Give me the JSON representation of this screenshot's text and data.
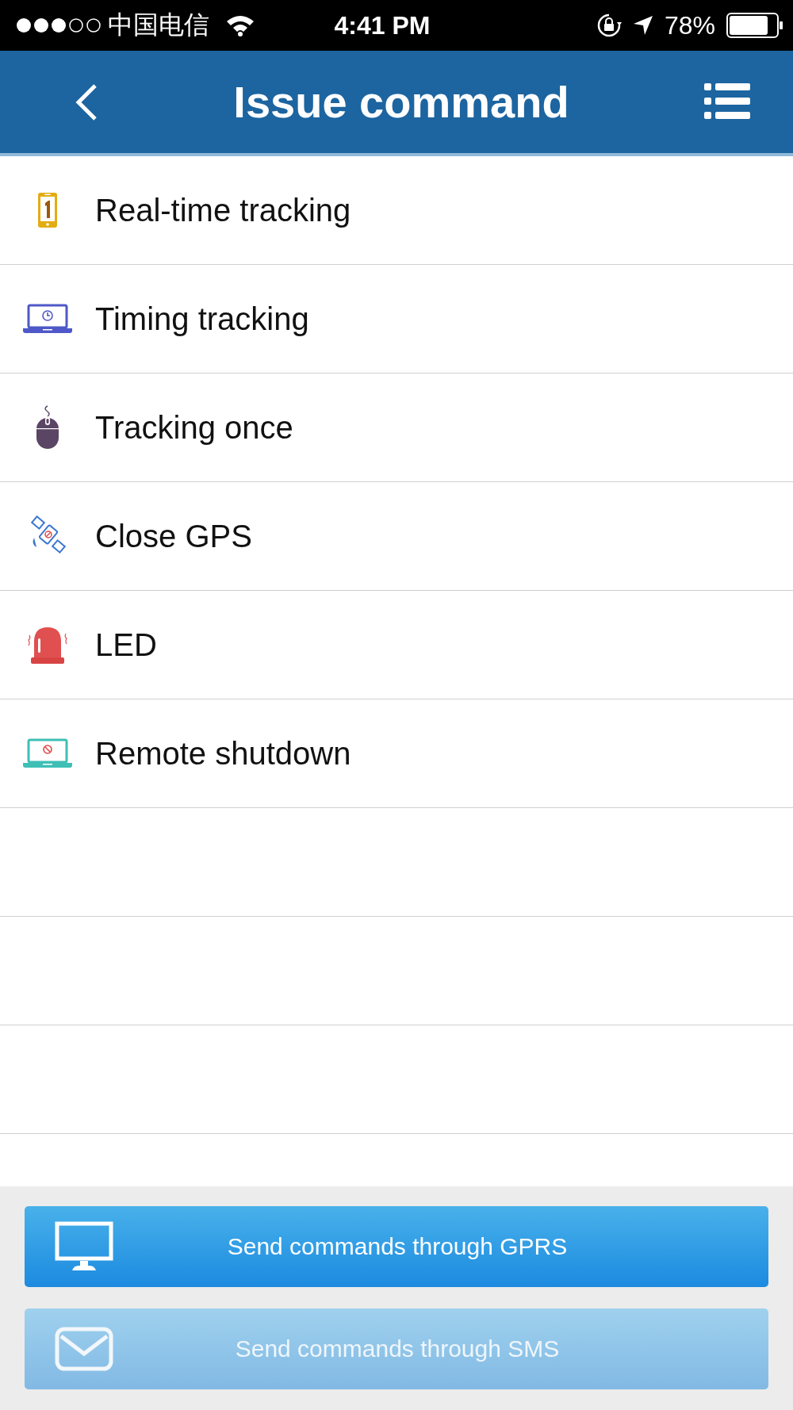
{
  "status_bar": {
    "carrier": "中国电信",
    "time": "4:41 PM",
    "battery": "78%"
  },
  "nav": {
    "title": "Issue command"
  },
  "commands": [
    {
      "label": "Real-time tracking",
      "kind": "phone"
    },
    {
      "label": "Timing tracking",
      "kind": "laptop-clock"
    },
    {
      "label": "Tracking once",
      "kind": "mouse"
    },
    {
      "label": "Close GPS",
      "kind": "satellite"
    },
    {
      "label": "LED",
      "kind": "siren"
    },
    {
      "label": "Remote shutdown",
      "kind": "laptop-block"
    }
  ],
  "buttons": [
    {
      "label": "Send commands through GPRS",
      "kind": "monitor",
      "disabled": false
    },
    {
      "label": "Send commands through SMS",
      "kind": "mail",
      "disabled": true
    }
  ]
}
